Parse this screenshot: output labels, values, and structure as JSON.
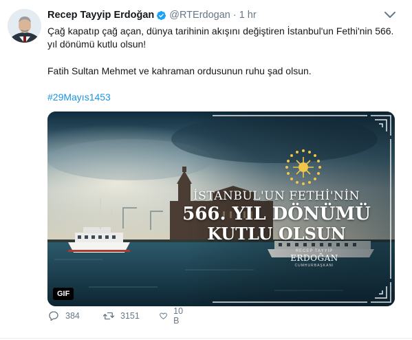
{
  "tweet": {
    "author_name": "Recep Tayyip Erdoğan",
    "handle": "@RTErdogan",
    "separator": "·",
    "time": "1 hr",
    "text_line1": "Çağ kapatıp çağ açan, dünya tarihinin akışını değiştiren İstanbul'un Fethi'nin 566. yıl dönümü kutlu olsun!",
    "text_line2": "Fatih Sultan Mehmet ve kahraman ordusunun ruhu şad olsun.",
    "hashtag": "#29Mayıs1453",
    "media": {
      "overlay_line1": "İSTANBUL'UN FETHİ'NİN",
      "overlay_line2": "566. YIL DÖNÜMÜ",
      "overlay_line3": "KUTLU OLSUN",
      "signature_top": "RECEP TAYYİP",
      "signature_name": "ERDOĞAN",
      "signature_bottom": "CUMHURBAŞKANI",
      "badge": "GIF"
    },
    "actions": {
      "replies": "384",
      "retweets": "3151",
      "likes": "10 B"
    },
    "colors": {
      "link": "#1b95e0",
      "secondary": "#657786",
      "verified": "#1da1f2"
    },
    "icons": [
      "verified-badge-icon",
      "caret-down-icon",
      "reply-icon",
      "retweet-icon",
      "like-icon"
    ]
  }
}
